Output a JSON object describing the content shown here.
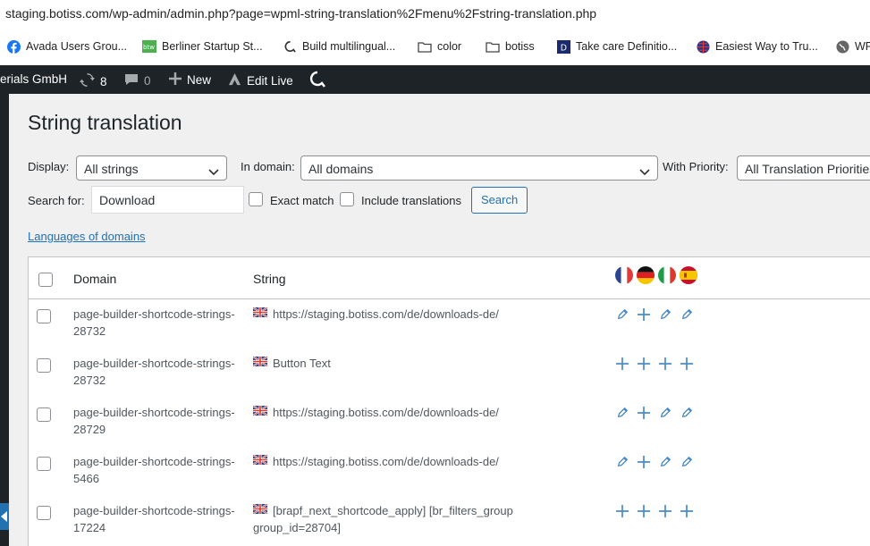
{
  "browser": {
    "url": "staging.botiss.com/wp-admin/admin.php?page=wpml-string-translation%2Fmenu%2Fstring-translation.php",
    "bookmarks": [
      {
        "label": "Avada Users Grou...",
        "icon": "facebook-icon"
      },
      {
        "label": "Berliner Startup St...",
        "icon": "startup-icon"
      },
      {
        "label": "Build multilingual...",
        "icon": "wpml-icon"
      },
      {
        "label": "color",
        "icon": "folder-icon"
      },
      {
        "label": "botiss",
        "icon": "folder-icon"
      },
      {
        "label": "Take care Definitio...",
        "icon": "dictionary-icon"
      },
      {
        "label": "Easiest Way to Tru...",
        "icon": "globe-icon"
      },
      {
        "label": "WP",
        "icon": "world-icon"
      }
    ]
  },
  "adminbar": {
    "site_name": "erials GmbH",
    "updates_count": "8",
    "comments_count": "0",
    "new_label": "New",
    "edit_live_label": "Edit Live"
  },
  "page": {
    "title": "String translation",
    "filters": {
      "display_label": "Display:",
      "display_value": "All strings",
      "domain_label": "In domain:",
      "domain_value": "All domains",
      "priority_label": "With Priority:",
      "priority_value": "All Translation Priorities",
      "search_label": "Search for:",
      "search_value": "Download",
      "exact_match_label": "Exact match",
      "include_translations_label": "Include translations",
      "search_button": "Search"
    },
    "languages_link": "Languages of domains",
    "table": {
      "columns": {
        "domain": "Domain",
        "string": "String"
      },
      "languages": [
        "French",
        "German",
        "Italian",
        "Spanish"
      ],
      "rows": [
        {
          "domain": "page-builder-shortcode-strings-28732",
          "string": "https://staging.botiss.com/de/downloads-de/",
          "actions": [
            "edit",
            "add",
            "edit",
            "edit"
          ]
        },
        {
          "domain": "page-builder-shortcode-strings-28732",
          "string": "Button Text",
          "actions": [
            "add",
            "add",
            "add",
            "add"
          ]
        },
        {
          "domain": "page-builder-shortcode-strings-28729",
          "string": "https://staging.botiss.com/de/downloads-de/",
          "actions": [
            "edit",
            "add",
            "edit",
            "edit"
          ]
        },
        {
          "domain": "page-builder-shortcode-strings-5466",
          "string": "https://staging.botiss.com/de/downloads-de/",
          "actions": [
            "edit",
            "add",
            "edit",
            "edit"
          ]
        },
        {
          "domain": "page-builder-shortcode-strings-17224",
          "string": "[brapf_next_shortcode_apply] [br_filters_group group_id=28704]",
          "actions": [
            "add",
            "add",
            "add",
            "add"
          ]
        }
      ]
    }
  },
  "colors": {
    "accent": "#2271b1",
    "adminbar": "#1d2327",
    "action_icon": "#4a8bc7"
  }
}
